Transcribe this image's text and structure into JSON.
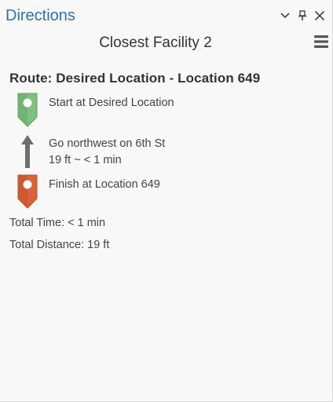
{
  "pane": {
    "title": "Directions",
    "buttons": {
      "collapse_icon": "chevron-down-icon",
      "pin_icon": "pin-icon",
      "close_icon": "close-icon"
    }
  },
  "header": {
    "facility_name": "Closest Facility 2",
    "menu_icon": "hamburger-menu-icon"
  },
  "route": {
    "title": "Route: Desired Location - Location 649",
    "steps": [
      {
        "icon": "green-start-pin-icon",
        "text": "Start at Desired Location"
      },
      {
        "icon": "up-arrow-icon",
        "text": "Go northwest on 6th St",
        "subtext": "19 ft ~ < 1 min"
      },
      {
        "icon": "orange-finish-pin-icon",
        "text": "Finish at Location 649"
      }
    ],
    "total_time": "Total Time: < 1 min",
    "total_distance": "Total Distance: 19 ft"
  },
  "colors": {
    "title_blue": "#2f6fb3",
    "start_pin": "#7fbf7f",
    "finish_pin": "#d9623b",
    "arrow": "#6e6e6e"
  }
}
